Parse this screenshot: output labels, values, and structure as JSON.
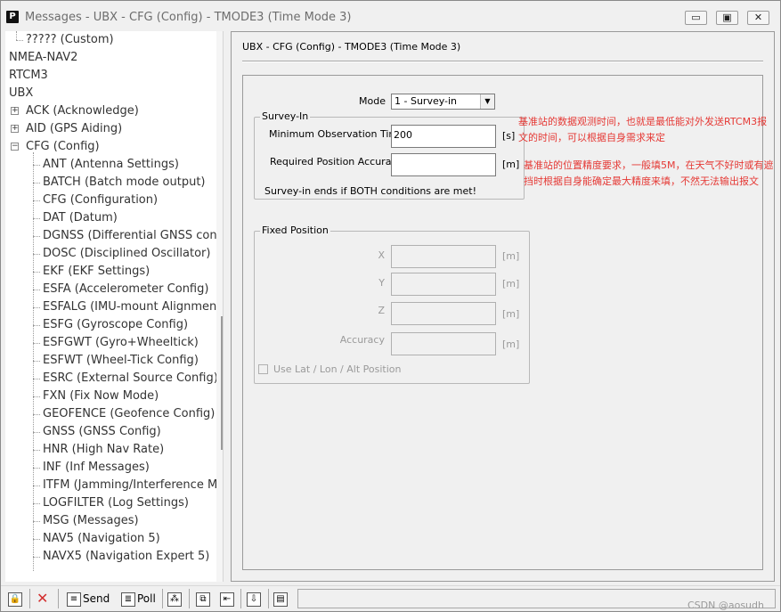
{
  "window": {
    "title": "Messages - UBX - CFG (Config) - TMODE3 (Time Mode 3)",
    "app_icon": "P",
    "controls": {
      "minimize": "▭",
      "restore": "▣",
      "close": "✕"
    }
  },
  "tree": {
    "items": [
      {
        "label": "????? (Custom)",
        "level": 1,
        "expander": ""
      },
      {
        "label": "NMEA-NAV2",
        "level": 0,
        "expander": ""
      },
      {
        "label": "RTCM3",
        "level": 0,
        "expander": ""
      },
      {
        "label": "UBX",
        "level": 0,
        "expander": ""
      },
      {
        "label": "ACK (Acknowledge)",
        "level": 1,
        "expander": "+"
      },
      {
        "label": "AID (GPS Aiding)",
        "level": 1,
        "expander": "+"
      },
      {
        "label": "CFG (Config)",
        "level": 1,
        "expander": "−"
      },
      {
        "label": "ANT (Antenna Settings)",
        "level": 2,
        "expander": ""
      },
      {
        "label": "BATCH (Batch mode output)",
        "level": 2,
        "expander": ""
      },
      {
        "label": "CFG (Configuration)",
        "level": 2,
        "expander": ""
      },
      {
        "label": "DAT (Datum)",
        "level": 2,
        "expander": ""
      },
      {
        "label": "DGNSS (Differential GNSS config",
        "level": 2,
        "expander": ""
      },
      {
        "label": "DOSC (Disciplined Oscillator)",
        "level": 2,
        "expander": ""
      },
      {
        "label": "EKF (EKF Settings)",
        "level": 2,
        "expander": ""
      },
      {
        "label": "ESFA (Accelerometer Config)",
        "level": 2,
        "expander": ""
      },
      {
        "label": "ESFALG (IMU-mount Alignment)",
        "level": 2,
        "expander": ""
      },
      {
        "label": "ESFG (Gyroscope Config)",
        "level": 2,
        "expander": ""
      },
      {
        "label": "ESFGWT (Gyro+Wheeltick)",
        "level": 2,
        "expander": ""
      },
      {
        "label": "ESFWT (Wheel-Tick Config)",
        "level": 2,
        "expander": ""
      },
      {
        "label": "ESRC (External Source Config)",
        "level": 2,
        "expander": ""
      },
      {
        "label": "FXN (Fix Now Mode)",
        "level": 2,
        "expander": ""
      },
      {
        "label": "GEOFENCE (Geofence Config)",
        "level": 2,
        "expander": ""
      },
      {
        "label": "GNSS (GNSS Config)",
        "level": 2,
        "expander": ""
      },
      {
        "label": "HNR (High Nav Rate)",
        "level": 2,
        "expander": ""
      },
      {
        "label": "INF (Inf Messages)",
        "level": 2,
        "expander": ""
      },
      {
        "label": "ITFM (Jamming/Interference Mo",
        "level": 2,
        "expander": ""
      },
      {
        "label": "LOGFILTER (Log Settings)",
        "level": 2,
        "expander": ""
      },
      {
        "label": "MSG (Messages)",
        "level": 2,
        "expander": ""
      },
      {
        "label": "NAV5 (Navigation 5)",
        "level": 2,
        "expander": ""
      },
      {
        "label": "NAVX5 (Navigation Expert 5)",
        "level": 2,
        "expander": ""
      }
    ]
  },
  "panel": {
    "header": "UBX - CFG (Config) - TMODE3 (Time Mode 3)",
    "mode_label": "Mode",
    "mode_value": "1 - Survey-in",
    "survey_in": {
      "title": "Survey-In",
      "min_obs_label": "Minimum Observation Time",
      "min_obs_value": "200",
      "min_obs_unit": "[s]",
      "req_acc_label": "Required Position Accuracy",
      "req_acc_value": "",
      "req_acc_unit": "[m]",
      "note": "Survey-in ends if BOTH conditions are met!"
    },
    "fixed_position": {
      "title": "Fixed Position",
      "x_label": "X",
      "x_unit": "[m]",
      "y_label": "Y",
      "y_unit": "[m]",
      "z_label": "Z",
      "z_unit": "[m]",
      "acc_label": "Accuracy",
      "acc_unit": "[m]",
      "checkbox_label": "Use Lat / Lon / Alt Position"
    },
    "annotations": {
      "note1": "基准站的数据观测时间，也就是最低能对外发送RTCM3报文的时间，可以根据自身需求来定",
      "note2": "基准站的位置精度要求，一般填5M，在天气不好时或有遮挡时根据自身能确定最大精度来填，不然无法输出报文"
    }
  },
  "toolbar": {
    "send_label": "Send",
    "poll_label": "Poll",
    "watermark": "CSDN @aosudh"
  },
  "colors": {
    "annotation": "#e53935",
    "window_bg": "#f0f0f0"
  }
}
